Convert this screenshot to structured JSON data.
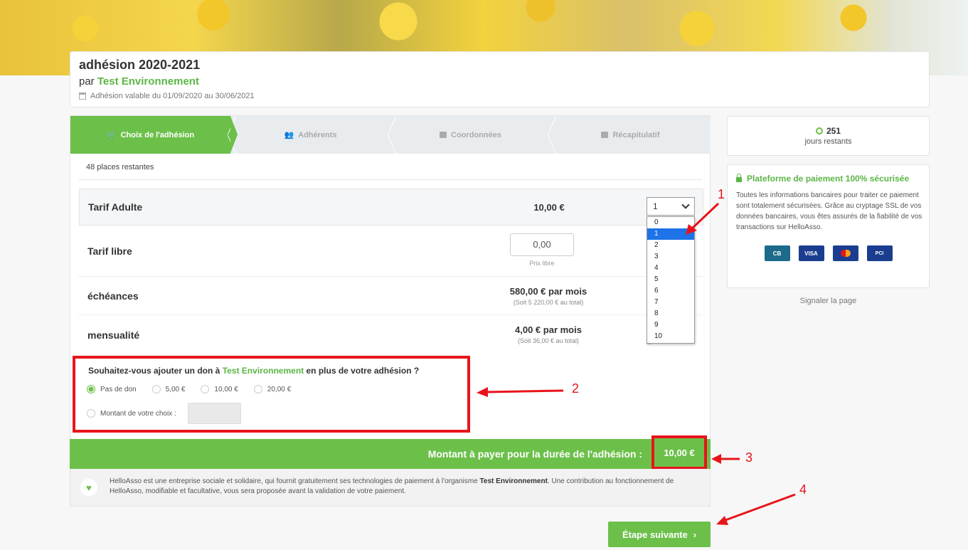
{
  "header": {
    "title": "adhésion 2020-2021",
    "by_prefix": "par",
    "org": "Test Environnement",
    "validity": "Adhésion valable du 01/09/2020 au 30/06/2021"
  },
  "steps": [
    {
      "label": "Choix de l'adhésion",
      "icon": "cart-icon"
    },
    {
      "label": "Adhérents",
      "icon": "users-icon"
    },
    {
      "label": "Coordonnées",
      "icon": "list-icon"
    },
    {
      "label": "Récapitulatif",
      "icon": "check-square-icon"
    }
  ],
  "places": "48 places restantes",
  "tarifs": {
    "adulte": {
      "name": "Tarif Adulte",
      "price": "10,00 €",
      "qty": "1"
    },
    "libre": {
      "name": "Tarif libre",
      "value": "0,00",
      "hint": "Prix libre"
    },
    "echeances": {
      "name": "échéances",
      "price": "580,00 € par mois",
      "sub": "(Soit 5 220,00 € au total)"
    },
    "mensualite": {
      "name": "mensualité",
      "price": "4,00 € par mois",
      "sub": "(Soit 36,00 € au total)"
    }
  },
  "qty_options": [
    "0",
    "1",
    "2",
    "3",
    "4",
    "5",
    "6",
    "7",
    "8",
    "9",
    "10"
  ],
  "don": {
    "question_prefix": "Souhaitez-vous ajouter un don à",
    "org": "Test Environnement",
    "question_suffix": "en plus de votre adhésion ?",
    "options": [
      "Pas de don",
      "5,00 €",
      "10,00 €",
      "20,00 €"
    ],
    "custom_label": "Montant de votre choix :"
  },
  "total": {
    "label": "Montant à payer pour la durée de l'adhésion :",
    "amount": "10,00 €"
  },
  "info": {
    "text_1": "HelloAsso est une entreprise sociale et solidaire, qui fournit gratuitement ses technologies de paiement à l'organisme",
    "org": "Test Environnement",
    "text_2": ". Une contribution au fonctionnement de HelloAsso, modifiable et facultative, vous sera proposée avant la validation de votre paiement."
  },
  "next_button": "Étape suivante",
  "sidebar": {
    "days_count": "251",
    "days_label": "jours restants",
    "secure_title": "Plateforme de paiement 100% sécurisée",
    "secure_text": "Toutes les informations bancaires pour traiter ce paiement sont totalement sécurisées. Grâce au cryptage SSL de vos données bancaires, vous êtes assurés de la fiabilité de vos transactions sur HelloAsso.",
    "cards": [
      "CB",
      "VISA",
      "",
      "PCI"
    ],
    "report": "Signaler la page"
  },
  "annotations": [
    "1",
    "2",
    "3",
    "4"
  ],
  "colors": {
    "accent": "#6cc04a",
    "org_text": "#5bb645",
    "annotation": "#e8141b",
    "selected_option": "#1e73e8"
  }
}
